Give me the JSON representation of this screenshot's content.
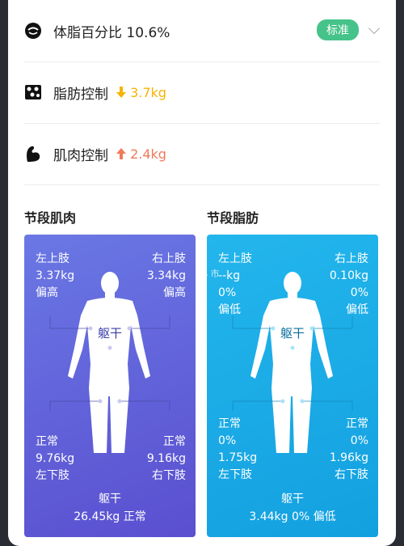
{
  "rows": {
    "bodyfat": {
      "label": "体脂百分比 10.6%",
      "badge": "标准"
    },
    "fat_control": {
      "label": "脂肪控制",
      "value": "3.7kg",
      "color": "#f5b400"
    },
    "muscle_control": {
      "label": "肌肉控制",
      "value": "2.4kg",
      "color": "#f07a5a"
    }
  },
  "sections": {
    "muscle_title": "节段肌肉",
    "fat_title": "节段脂肪"
  },
  "muscle": {
    "left_arm": {
      "name": "左上肢",
      "value": "3.37kg",
      "status": "偏高"
    },
    "right_arm": {
      "name": "右上肢",
      "value": "3.34kg",
      "status": "偏高"
    },
    "left_leg": {
      "status": "正常",
      "value": "9.76kg",
      "name": "左下肢"
    },
    "right_leg": {
      "status": "正常",
      "value": "9.16kg",
      "name": "右下肢"
    },
    "trunk_mid": "躯干",
    "trunk": {
      "name": "躯干",
      "value": "26.45kg 正常"
    }
  },
  "fat": {
    "left_arm": {
      "name": "左上肢",
      "value": "--kg",
      "pct": "0%",
      "status": "偏低"
    },
    "right_arm": {
      "name": "右上肢",
      "value": "0.10kg",
      "pct": "0%",
      "status": "偏低"
    },
    "left_leg": {
      "status": "正常",
      "pct": "0%",
      "value": "1.75kg",
      "name": "左下肢"
    },
    "right_leg": {
      "status": "正常",
      "pct": "0%",
      "value": "1.96kg",
      "name": "右下肢"
    },
    "trunk_mid": "躯干",
    "trunk": {
      "name": "躯干",
      "value": "3.44kg 0% 偏低"
    }
  },
  "watermark": "小 市",
  "icons": {
    "bodyfat": "scale-face-icon",
    "fat": "fat-cells-icon",
    "muscle": "flexed-arm-icon",
    "arrow_down": "arrow-down-icon",
    "arrow_up": "arrow-up-icon",
    "chevron": "chevron-down-icon"
  }
}
